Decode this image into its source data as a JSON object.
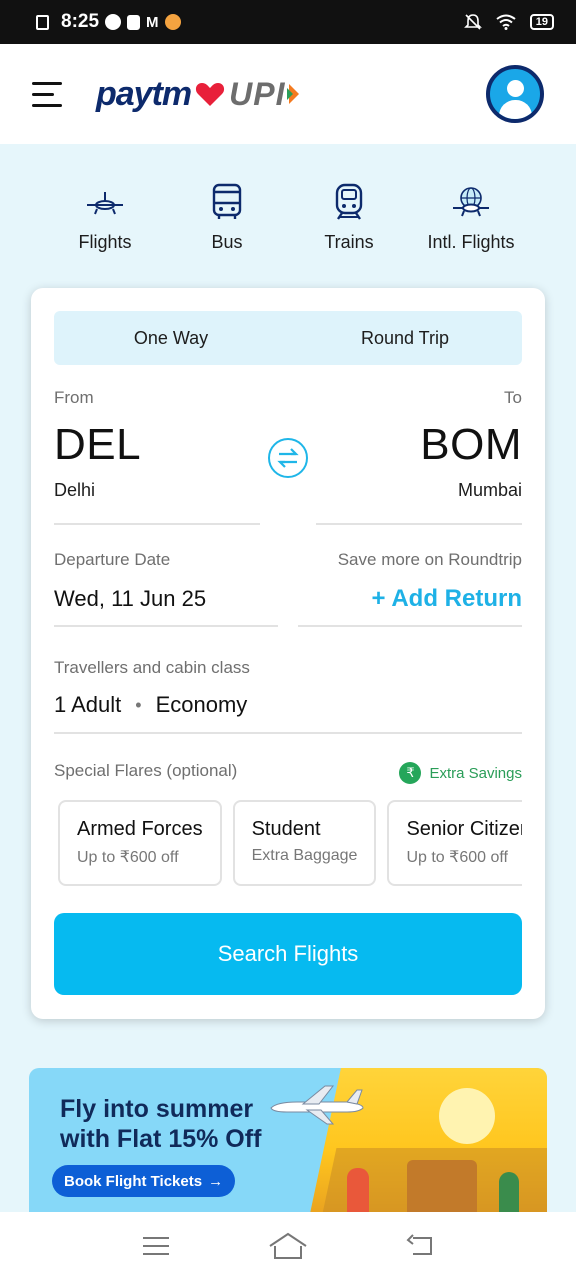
{
  "status_bar": {
    "time": "8:25",
    "battery": "19"
  },
  "header": {
    "logo_text": "paytm",
    "logo_upi": "UPI",
    "menu_icon": "hamburger-icon",
    "avatar_icon": "user-avatar-icon"
  },
  "categories": [
    {
      "label": "Flights",
      "icon": "flight-icon"
    },
    {
      "label": "Bus",
      "icon": "bus-icon"
    },
    {
      "label": "Trains",
      "icon": "train-icon"
    },
    {
      "label": "Intl. Flights",
      "icon": "intl-flight-icon"
    }
  ],
  "search": {
    "trip_types": [
      "One Way",
      "Round Trip"
    ],
    "from": {
      "label": "From",
      "code": "DEL",
      "city": "Delhi"
    },
    "to": {
      "label": "To",
      "code": "BOM",
      "city": "Mumbai"
    },
    "departure": {
      "label": "Departure Date",
      "value": "Wed, 11 Jun 25"
    },
    "return": {
      "label": "Save more on Roundtrip",
      "action": "+ Add Return"
    },
    "travellers": {
      "label": "Travellers and cabin class",
      "count": "1 Adult",
      "dot": "•",
      "cabin": "Economy"
    },
    "special_fares": {
      "label": "Special Flares (optional)",
      "savings_icon": "₹",
      "savings_label": "Extra Savings",
      "options": [
        {
          "title": "Armed Forces",
          "subtitle": "Up to ₹600 off"
        },
        {
          "title": "Student",
          "subtitle": "Extra Baggage"
        },
        {
          "title": "Senior Citizen",
          "subtitle": "Up to ₹600 off"
        }
      ]
    },
    "button": "Search Flights"
  },
  "banner": {
    "headline_line1": "Fly into summer",
    "headline_line2": "with Flat 15% Off",
    "button": "Book Flight Tickets",
    "button_arrow": "→"
  },
  "colors": {
    "accent": "#06baf0",
    "navy": "#0d2a6c",
    "background": "#e6f6fb",
    "savings_green": "#25a65a"
  }
}
